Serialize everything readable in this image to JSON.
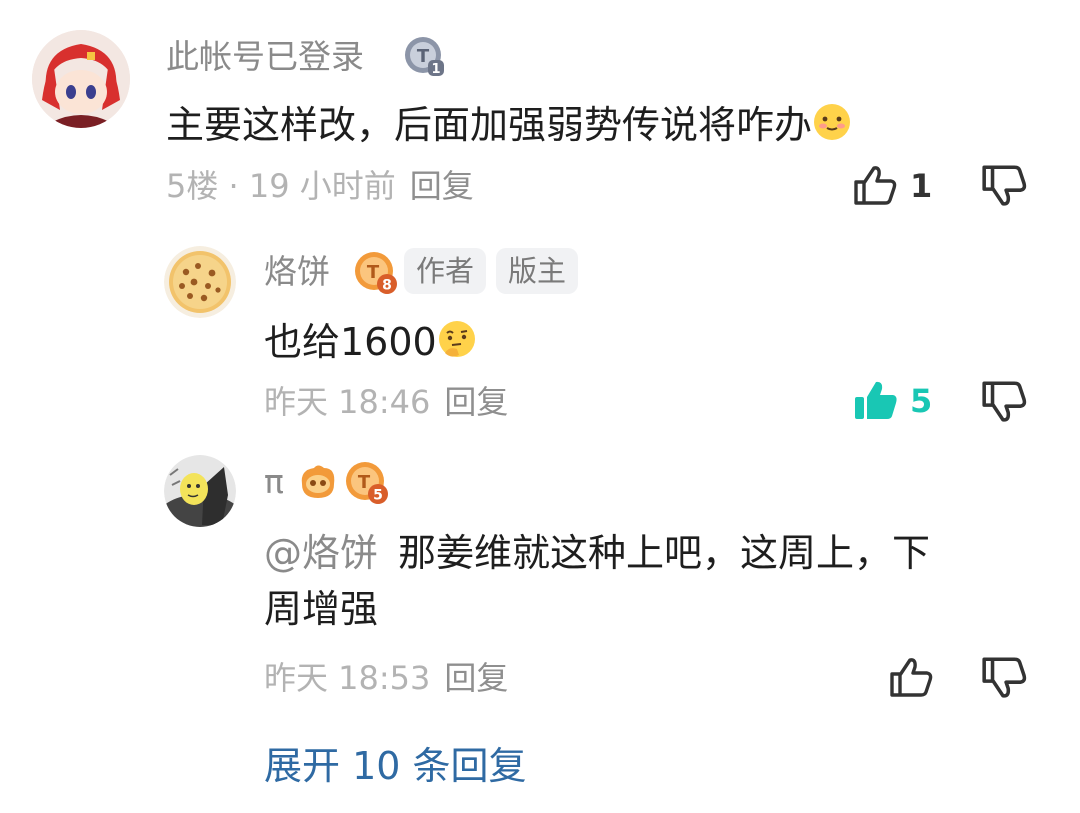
{
  "comments": [
    {
      "author": "此帐号已登录",
      "text": "主要这样改，后面加强弱势传说将咋办",
      "meta_floor": "5楼 · 19 小时前",
      "reply_label": "回复",
      "likes": "1"
    },
    {
      "author": "烙饼",
      "level_badge": "8",
      "tags": [
        "作者",
        "版主"
      ],
      "text": "也给1600",
      "meta_time": "昨天 18:46",
      "reply_label": "回复",
      "likes": "5"
    },
    {
      "author": "π",
      "level_badge": "5",
      "mention": "@烙饼",
      "text": "那姜维就这种上吧，这周上，下周增强",
      "text_line1": "那姜维就这种上吧，这周上，下",
      "text_line2": "周增强",
      "meta_time": "昨天 18:53",
      "reply_label": "回复"
    }
  ],
  "expand_replies": "展开 10 条回复",
  "colors": {
    "liked": "#19c7b4",
    "link": "#2f6aa3",
    "badge_orange": "#f29a3a",
    "badge_gray": "#8c95a8"
  },
  "icons": [
    "thumbs-up-icon",
    "thumbs-down-icon",
    "slightly-smiling-emoji",
    "thinking-emoji"
  ]
}
